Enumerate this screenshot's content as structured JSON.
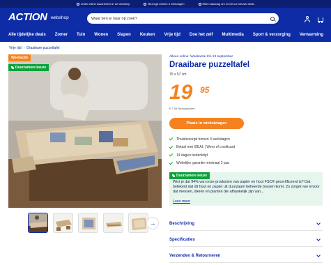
{
  "topbar": {
    "usps": [
      "Uniek online assortiment in de webshop",
      "Bezorgd binnen 3 werkdagen",
      "Elke maandag om 12.00 uur nieuwe deals"
    ]
  },
  "header": {
    "logo": "ACTION",
    "logo_sub": "webshop",
    "search_placeholder": "Waar ben je naar op zoek?"
  },
  "nav": {
    "items": [
      "Alle tijdelijke deals",
      "Zomer",
      "Tuin",
      "Wonen",
      "Slapen",
      "Keuken",
      "Vrije tijd",
      "Doe het zelf",
      "Multimedia",
      "Sport & verzorging",
      "Verwarming"
    ]
  },
  "breadcrumb": {
    "parent": "Vrije tijd",
    "current": "Draaibare puzzeltafel"
  },
  "gallery": {
    "badge_sale": "Weekactie",
    "badge_sustainable": "Duurzamere keuze",
    "thumb_count": 5
  },
  "product": {
    "availability": "Alleen online: Weekactie t/m 13 september",
    "title": "Draaibare puzzeltafel",
    "dimensions": "76 x 57 cm",
    "price_main": "19",
    "price_cents": "95",
    "deposit": "€ 7,99 Bezorgkosten",
    "cta": "Plaats in winkelwagen",
    "usps": [
      "Thuisbezorgd binnen 3 werkdagen",
      "Betaal met iDEAL | Wero of creditcard",
      "14 dagen bedenktijd",
      "Wettelijke garantie minimaal 2 jaar"
    ]
  },
  "sustainability": {
    "badge": "Duurzamere keuze",
    "text": "Wist je dat 94% van onze producten van papier en hout FSC® gecertificeerd is? Dat betekent dat dit hout en papier uit duurzaam beheerde bossen komt. Zo zorgen we ervoor dat mensen, dieren en planten die afhankelijk zijn van...",
    "more": "Lees meer"
  },
  "accordion": [
    "Beschrijving",
    "Specificaties",
    "Verzenden & Retourneren"
  ],
  "colors": {
    "brand_blue": "#0d2ca6",
    "dark_blue": "#0b1e72",
    "orange": "#f5821f",
    "green": "#0aa33a"
  }
}
